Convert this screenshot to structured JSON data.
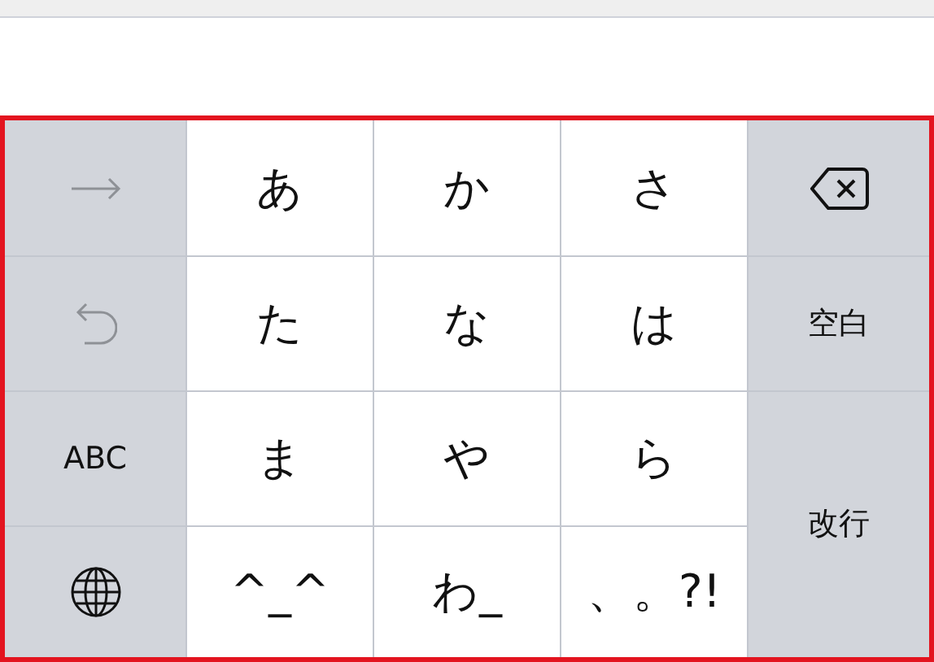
{
  "keyboard": {
    "keys": [
      {
        "kind": "arrow",
        "disabled": true
      },
      {
        "kind": "char",
        "label": "あ",
        "disabled": false
      },
      {
        "kind": "char",
        "label": "か",
        "disabled": false
      },
      {
        "kind": "char",
        "label": "さ",
        "disabled": false
      },
      {
        "kind": "delete",
        "disabled": false
      },
      {
        "kind": "undo",
        "disabled": true
      },
      {
        "kind": "char",
        "label": "た",
        "disabled": false
      },
      {
        "kind": "char",
        "label": "な",
        "disabled": false
      },
      {
        "kind": "char",
        "label": "は",
        "disabled": false
      },
      {
        "kind": "function",
        "label": "空白",
        "disabled": false
      },
      {
        "kind": "function",
        "label": "ABC",
        "disabled": false
      },
      {
        "kind": "char",
        "label": "ま",
        "disabled": false
      },
      {
        "kind": "char",
        "label": "や",
        "disabled": false
      },
      {
        "kind": "char",
        "label": "ら",
        "disabled": false
      },
      {
        "kind": "return",
        "label": "改行",
        "disabled": false
      },
      {
        "kind": "globe",
        "disabled": false
      },
      {
        "kind": "char",
        "label": "^_^",
        "disabled": false
      },
      {
        "kind": "char",
        "label": "わ_",
        "disabled": false
      },
      {
        "kind": "char",
        "label": "、。?!",
        "disabled": false
      }
    ]
  }
}
